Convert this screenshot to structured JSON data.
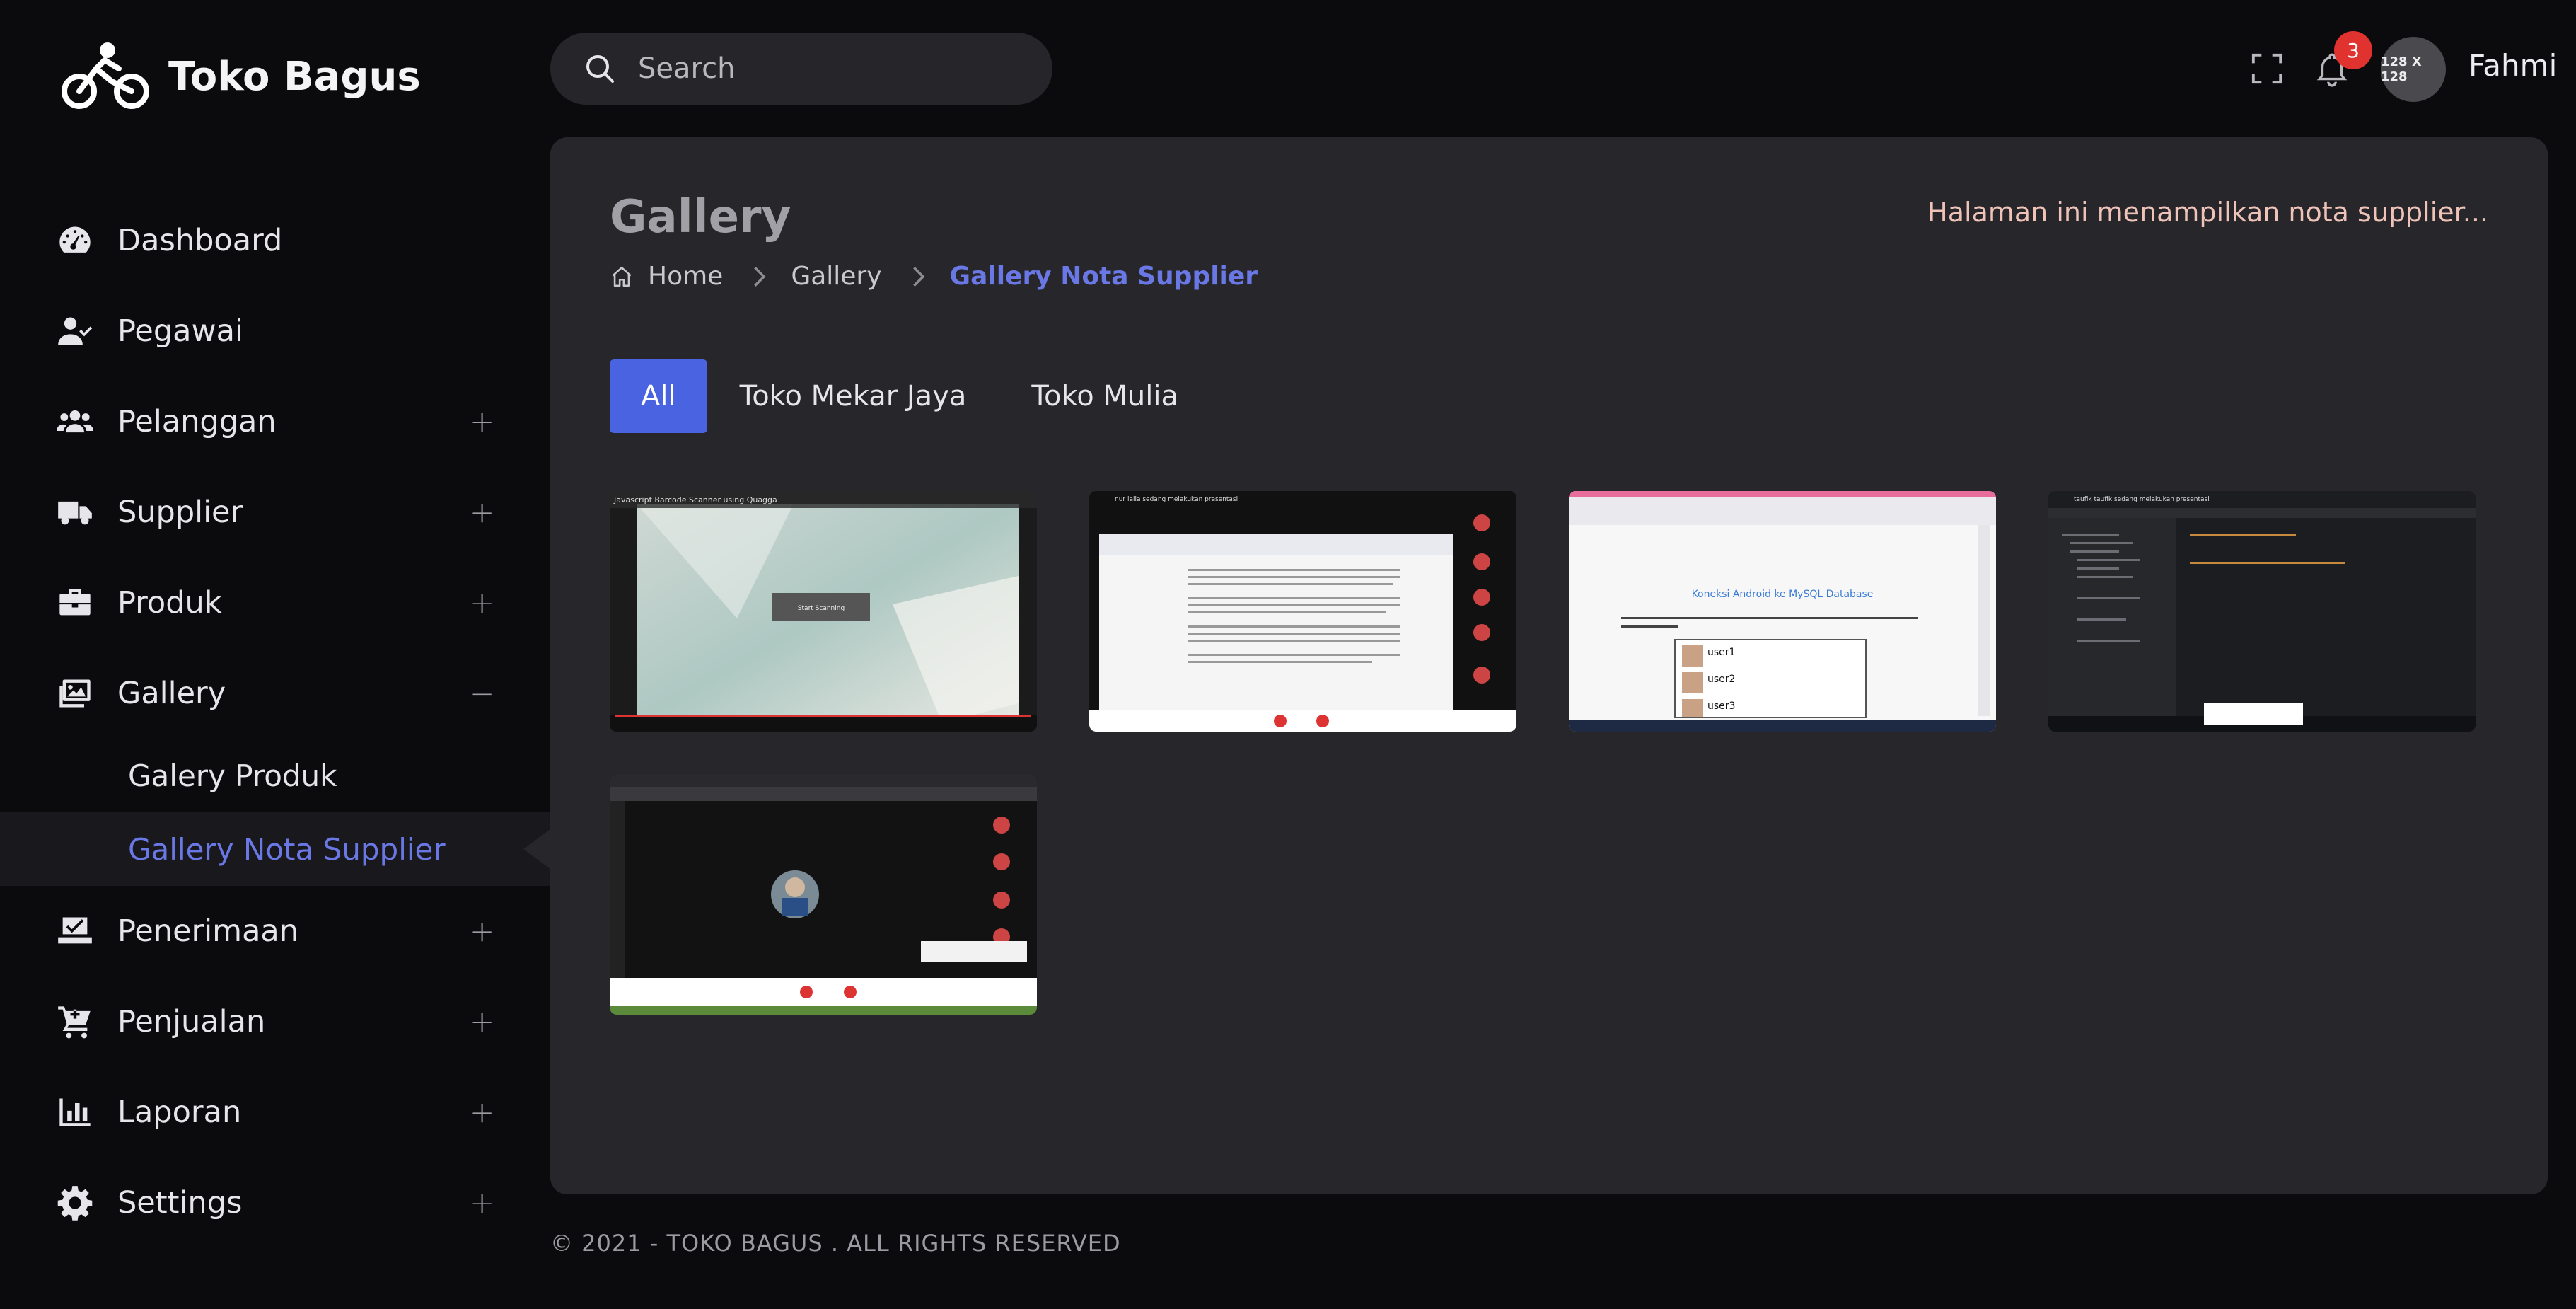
{
  "brand": {
    "name": "Toko Bagus"
  },
  "sidebar": {
    "items": [
      {
        "label": "Dashboard",
        "toggle": ""
      },
      {
        "label": "Pegawai",
        "toggle": ""
      },
      {
        "label": "Pelanggan",
        "toggle": "+"
      },
      {
        "label": "Supplier",
        "toggle": "+"
      },
      {
        "label": "Produk",
        "toggle": "+"
      },
      {
        "label": "Gallery",
        "toggle": "−"
      },
      {
        "label": "Penerimaan",
        "toggle": "+"
      },
      {
        "label": "Penjualan",
        "toggle": "+"
      },
      {
        "label": "Laporan",
        "toggle": "+"
      },
      {
        "label": "Settings",
        "toggle": "+"
      }
    ],
    "gallery_submenu": [
      {
        "label": "Galery Produk"
      },
      {
        "label": "Gallery Nota Supplier"
      }
    ]
  },
  "header": {
    "search_placeholder": "Search",
    "notification_count": "3",
    "avatar_text": "128 X 128",
    "username": "Fahmi"
  },
  "page": {
    "title": "Gallery",
    "description": "Halaman ini menampilkan nota supplier...",
    "breadcrumb": [
      "Home",
      "Gallery",
      "Gallery Nota Supplier"
    ],
    "filters": [
      "All",
      "Toko Mekar Jaya",
      "Toko Mulia"
    ],
    "active_filter": "All"
  },
  "gallery": {
    "thumbnails": [
      {
        "caption": "Javascript Barcode Scanner using Quagga",
        "button": "Start Scanning"
      },
      {
        "caption": "nur laila sedang melakukan presentasi"
      },
      {
        "caption": "Koneksi Android ke MySQL Database",
        "items": [
          "user1",
          "user2",
          "user3"
        ]
      },
      {
        "caption": "taufik taufik sedang melakukan presentasi"
      },
      {
        "caption": ""
      }
    ]
  },
  "footer": {
    "text": "© 2021 - TOKO BAGUS . ALL RIGHTS RESERVED"
  }
}
